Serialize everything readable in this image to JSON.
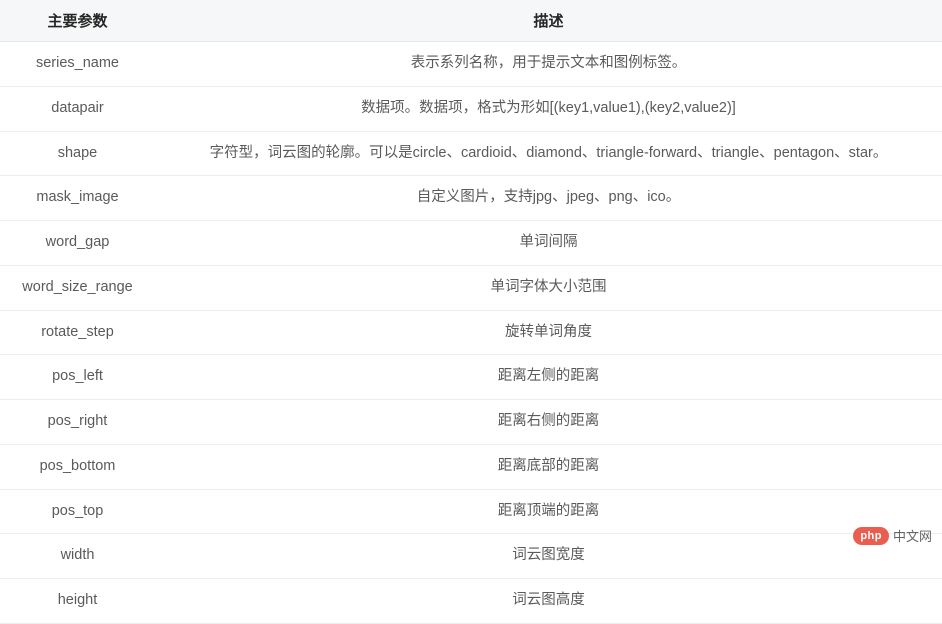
{
  "table": {
    "headers": {
      "param": "主要参数",
      "desc": "描述"
    },
    "rows": [
      {
        "param": "series_name",
        "desc": "表示系列名称，用于提示文本和图例标签。"
      },
      {
        "param": "datapair",
        "desc": "数据项。数据项，格式为形如[(key1,value1),(key2,value2)]"
      },
      {
        "param": "shape",
        "desc": "字符型，词云图的轮廓。可以是circle、cardioid、diamond、triangle-forward、triangle、pentagon、star。"
      },
      {
        "param": "mask_image",
        "desc": "自定义图片，支持jpg、jpeg、png、ico。"
      },
      {
        "param": "word_gap",
        "desc": "单词间隔"
      },
      {
        "param": "word_size_range",
        "desc": "单词字体大小范围"
      },
      {
        "param": "rotate_step",
        "desc": "旋转单词角度"
      },
      {
        "param": "pos_left",
        "desc": "距离左侧的距离"
      },
      {
        "param": "pos_right",
        "desc": "距离右侧的距离"
      },
      {
        "param": "pos_bottom",
        "desc": "距离底部的距离"
      },
      {
        "param": "pos_top",
        "desc": "距离顶端的距离"
      },
      {
        "param": "width",
        "desc": "词云图宽度"
      },
      {
        "param": "height",
        "desc": "词云图高度"
      }
    ]
  },
  "watermark": {
    "badge": "php",
    "text": "中文网"
  }
}
